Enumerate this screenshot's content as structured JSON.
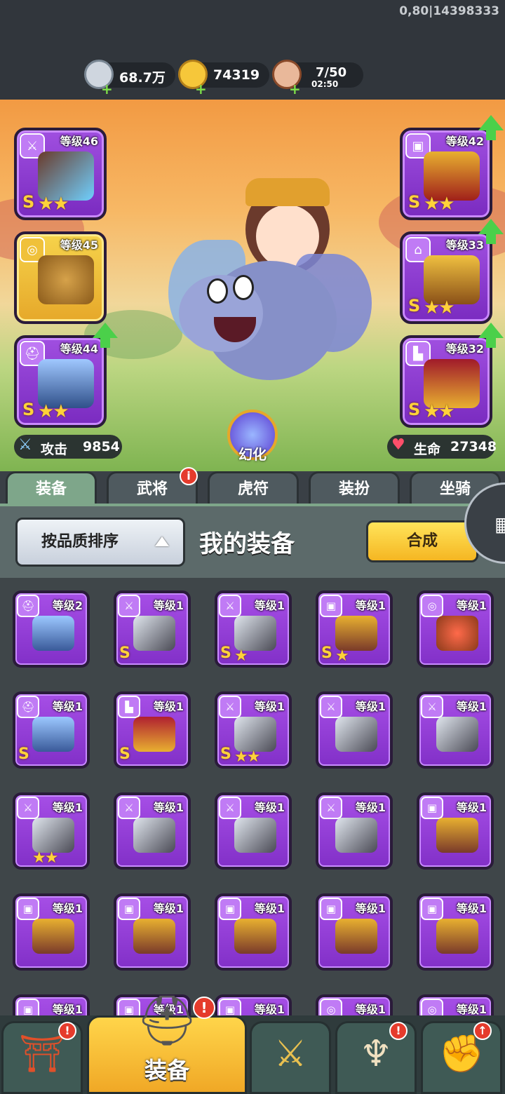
{
  "status": {
    "build_info": "0,80|14398333"
  },
  "resources": {
    "silver": {
      "value": "68.7万",
      "icon": "coin-icon"
    },
    "gold": {
      "value": "74319",
      "icon": "gold-ingot-icon"
    },
    "stamina": {
      "value": "7/50",
      "timer": "02:50",
      "icon": "meat-icon"
    }
  },
  "equipped": {
    "left": [
      {
        "slot": "weapon",
        "level": "等级46",
        "grade": "S",
        "stars": "★★"
      },
      {
        "slot": "medal",
        "level": "等级45",
        "grade": "",
        "stars": ""
      },
      {
        "slot": "helmet",
        "level": "等级44",
        "grade": "S",
        "stars": "★★"
      }
    ],
    "right": [
      {
        "slot": "armor",
        "level": "等级42",
        "grade": "S",
        "stars": "★★"
      },
      {
        "slot": "shoulder",
        "level": "等级33",
        "grade": "S",
        "stars": "★★"
      },
      {
        "slot": "boots",
        "level": "等级32",
        "grade": "S",
        "stars": "★★"
      }
    ]
  },
  "stats": {
    "attack_label": "攻击",
    "attack_value": "9854",
    "hp_label": "生命",
    "hp_value": "27348"
  },
  "transform_label": "幻化",
  "tabs": [
    "装备",
    "武将",
    "虎符",
    "装扮",
    "坐骑"
  ],
  "panel": {
    "sort_label": "按品质排序",
    "title": "我的装备",
    "combine_label": "合成"
  },
  "items": [
    {
      "type": "helmet",
      "level": "等级2",
      "grade": "",
      "stars": ""
    },
    {
      "type": "weapon",
      "level": "等级1",
      "grade": "S",
      "stars": ""
    },
    {
      "type": "weapon",
      "level": "等级1",
      "grade": "S",
      "stars": "★"
    },
    {
      "type": "armor",
      "level": "等级1",
      "grade": "S",
      "stars": "★"
    },
    {
      "type": "medal",
      "level": "等级1",
      "grade": "",
      "stars": ""
    },
    {
      "type": "helmet",
      "level": "等级1",
      "grade": "S",
      "stars": ""
    },
    {
      "type": "boots",
      "level": "等级1",
      "grade": "S",
      "stars": ""
    },
    {
      "type": "weapon",
      "level": "等级1",
      "grade": "S",
      "stars": "★★"
    },
    {
      "type": "weapon",
      "level": "等级1",
      "grade": "",
      "stars": ""
    },
    {
      "type": "weapon",
      "level": "等级1",
      "grade": "",
      "stars": ""
    },
    {
      "type": "weapon",
      "level": "等级1",
      "grade": "",
      "stars": "★★"
    },
    {
      "type": "weapon",
      "level": "等级1",
      "grade": "",
      "stars": ""
    },
    {
      "type": "weapon",
      "level": "等级1",
      "grade": "",
      "stars": ""
    },
    {
      "type": "weapon",
      "level": "等级1",
      "grade": "",
      "stars": ""
    },
    {
      "type": "armor",
      "level": "等级1",
      "grade": "",
      "stars": ""
    },
    {
      "type": "armor",
      "level": "等级1",
      "grade": "",
      "stars": ""
    },
    {
      "type": "armor",
      "level": "等级1",
      "grade": "",
      "stars": ""
    },
    {
      "type": "armor",
      "level": "等级1",
      "grade": "",
      "stars": ""
    },
    {
      "type": "armor",
      "level": "等级1",
      "grade": "",
      "stars": ""
    },
    {
      "type": "armor",
      "level": "等级1",
      "grade": "",
      "stars": ""
    },
    {
      "type": "armor",
      "level": "等级1",
      "grade": "",
      "stars": ""
    },
    {
      "type": "armor",
      "level": "等级1",
      "grade": "",
      "stars": ""
    },
    {
      "type": "armor",
      "level": "等级1",
      "grade": "",
      "stars": ""
    },
    {
      "type": "medal",
      "level": "等级1",
      "grade": "",
      "stars": ""
    },
    {
      "type": "medal",
      "level": "等级1",
      "grade": "",
      "stars": ""
    }
  ],
  "bottom_nav": [
    {
      "name": "shop",
      "label": "",
      "icon": "gate-icon",
      "badge": "!"
    },
    {
      "name": "equipment",
      "label": "装备",
      "icon": "helmet-icon",
      "badge": "!"
    },
    {
      "name": "battle",
      "label": "",
      "icon": "crossed-swords-icon",
      "badge": ""
    },
    {
      "name": "horn",
      "label": "",
      "icon": "horn-icon",
      "badge": "!"
    },
    {
      "name": "upgrade",
      "label": "",
      "icon": "fist-icon",
      "badge": "↑"
    }
  ],
  "colors": {
    "epic": "#8c38d2",
    "gold": "#f5c53a",
    "accent": "#7ea68a",
    "badge": "#e53b2c"
  }
}
